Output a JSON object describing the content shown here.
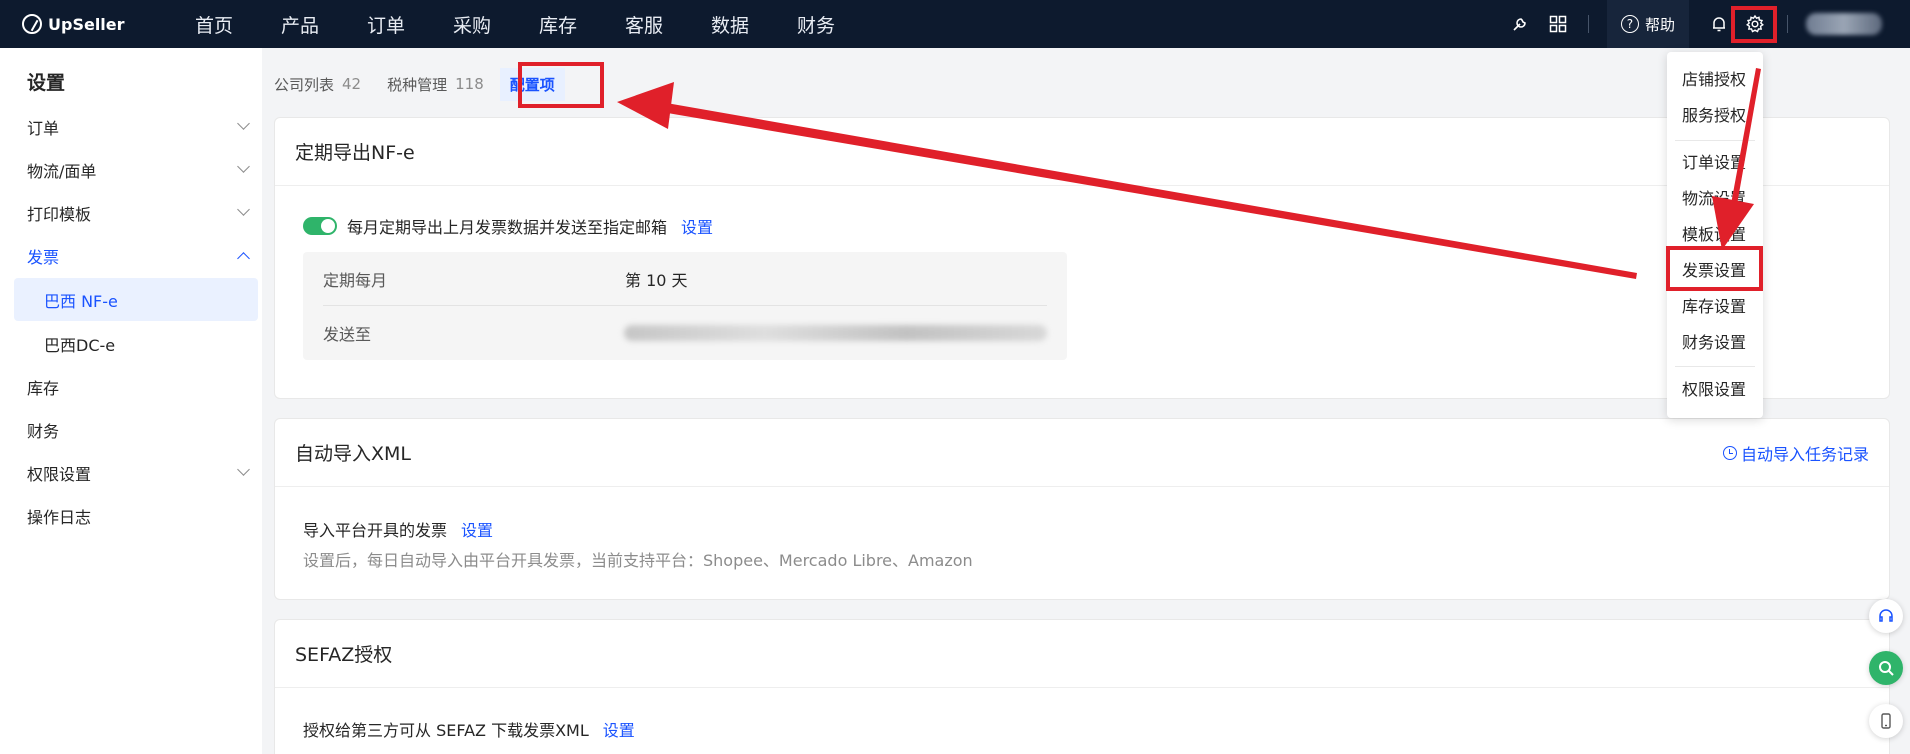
{
  "brand": {
    "name": "UpSeller"
  },
  "nav": {
    "items": [
      "首页",
      "产品",
      "订单",
      "采购",
      "库存",
      "客服",
      "数据",
      "财务"
    ]
  },
  "topbar": {
    "help_label": "帮助"
  },
  "sidebar": {
    "title": "设置",
    "items": [
      {
        "label": "订单"
      },
      {
        "label": "物流/面单"
      },
      {
        "label": "打印模板"
      },
      {
        "label": "发票"
      },
      {
        "label": "巴西 NF-e"
      },
      {
        "label": "巴西DC-e"
      },
      {
        "label": "库存"
      },
      {
        "label": "财务"
      },
      {
        "label": "权限设置"
      },
      {
        "label": "操作日志"
      }
    ]
  },
  "tabs": [
    {
      "label": "公司列表",
      "count": "42"
    },
    {
      "label": "税种管理",
      "count": "118"
    },
    {
      "label": "配置项"
    }
  ],
  "card_export": {
    "title": "定期导出NF-e",
    "toggle_label": "每月定期导出上月发票数据并发送至指定邮箱",
    "settings_link": "设置",
    "row1_label": "定期每月",
    "row1_value": "第 10 天",
    "row2_label": "发送至"
  },
  "card_xml": {
    "title": "自动导入XML",
    "record_link": "自动导入任务记录",
    "line1": "导入平台开具的发票",
    "settings_link": "设置",
    "line2": "设置后，每日自动导入由平台开具发票，当前支持平台：Shopee、Mercado Libre、Amazon"
  },
  "card_sefaz": {
    "title": "SEFAZ授权",
    "line1": "授权给第三方可从 SEFAZ 下载发票XML",
    "settings_link": "设置"
  },
  "dropdown": {
    "items": [
      "店铺授权",
      "服务授权",
      "订单设置",
      "物流设置",
      "模板设置",
      "发票设置",
      "库存设置",
      "财务设置",
      "权限设置"
    ]
  },
  "colors": {
    "accent": "#1a53ff",
    "nav_bg": "#0d1a2e",
    "highlight": "#e0202a",
    "toggle_on": "#2fb46a"
  }
}
